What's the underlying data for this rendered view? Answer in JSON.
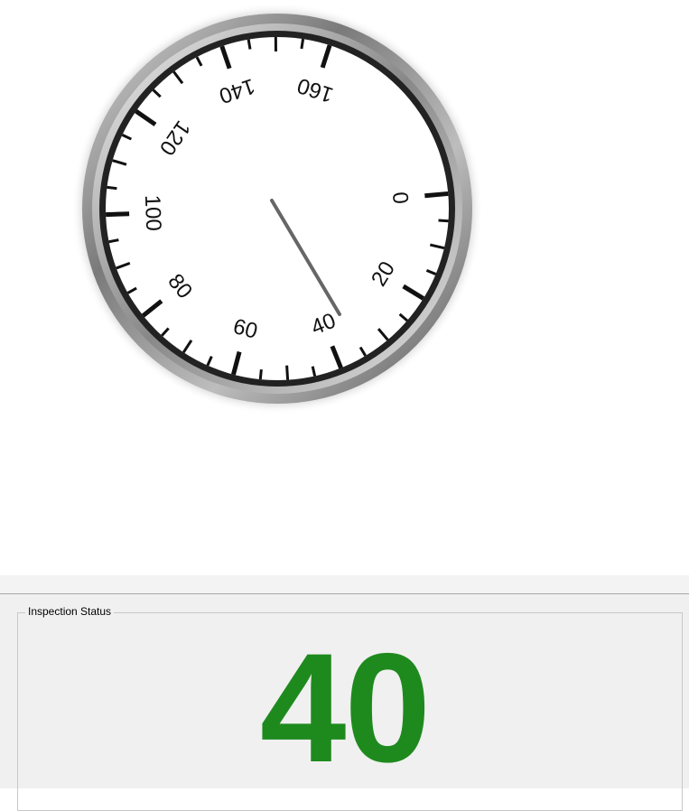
{
  "gauge": {
    "scale_labels": [
      "0",
      "20",
      "40",
      "60",
      "80",
      "100",
      "120",
      "140",
      "160"
    ],
    "scale_min": 0,
    "scale_max": 160,
    "needle_value": 40,
    "colors": {
      "bezel": "#8a8a8a",
      "scale": "#111111",
      "needle": "#666666",
      "face": "#ffffff"
    }
  },
  "status_panel": {
    "legend": "Inspection Status",
    "value": "40",
    "value_color": "#1e8a1e"
  }
}
